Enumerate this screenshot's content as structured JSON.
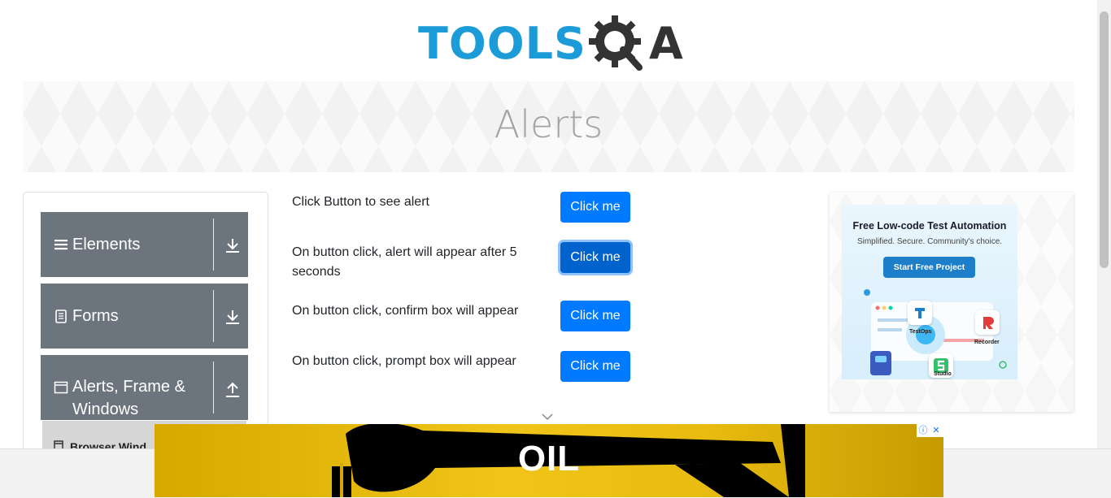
{
  "header": {
    "logo_text": "TOOLS",
    "logo_suffix": "A"
  },
  "banner": {
    "title": "Alerts"
  },
  "sidebar": {
    "groups": [
      {
        "label": "Elements",
        "icon": "hamburger-icon",
        "arrow": "download-icon"
      },
      {
        "label": "Forms",
        "icon": "document-icon",
        "arrow": "download-icon"
      },
      {
        "label": "Alerts, Frame & Windows",
        "icon": "window-icon",
        "arrow": "upload-icon"
      }
    ],
    "sub_item": "Browser Wind"
  },
  "main": {
    "rows": [
      {
        "text": "Click Button to see alert",
        "button": "Click me"
      },
      {
        "text": "On button click, alert will appear after 5 seconds",
        "button": "Click me"
      },
      {
        "text": "On button click, confirm box will appear",
        "button": "Click me"
      },
      {
        "text": "On button click, prompt box will appear",
        "button": "Click me"
      }
    ]
  },
  "ad_right": {
    "headline": "Free Low-code Test Automation",
    "subline": "Simplified. Secure. Community's choice.",
    "cta": "Start Free Project",
    "products": [
      "TestOps",
      "Recorder",
      "Studio"
    ]
  },
  "ad_bottom": {
    "text": "OIL",
    "info_icon": "ⓘ",
    "close_icon": "✕"
  },
  "colors": {
    "primary": "#007bff",
    "sidebar": "#6c757d",
    "logo_blue": "#1b9bd7"
  }
}
